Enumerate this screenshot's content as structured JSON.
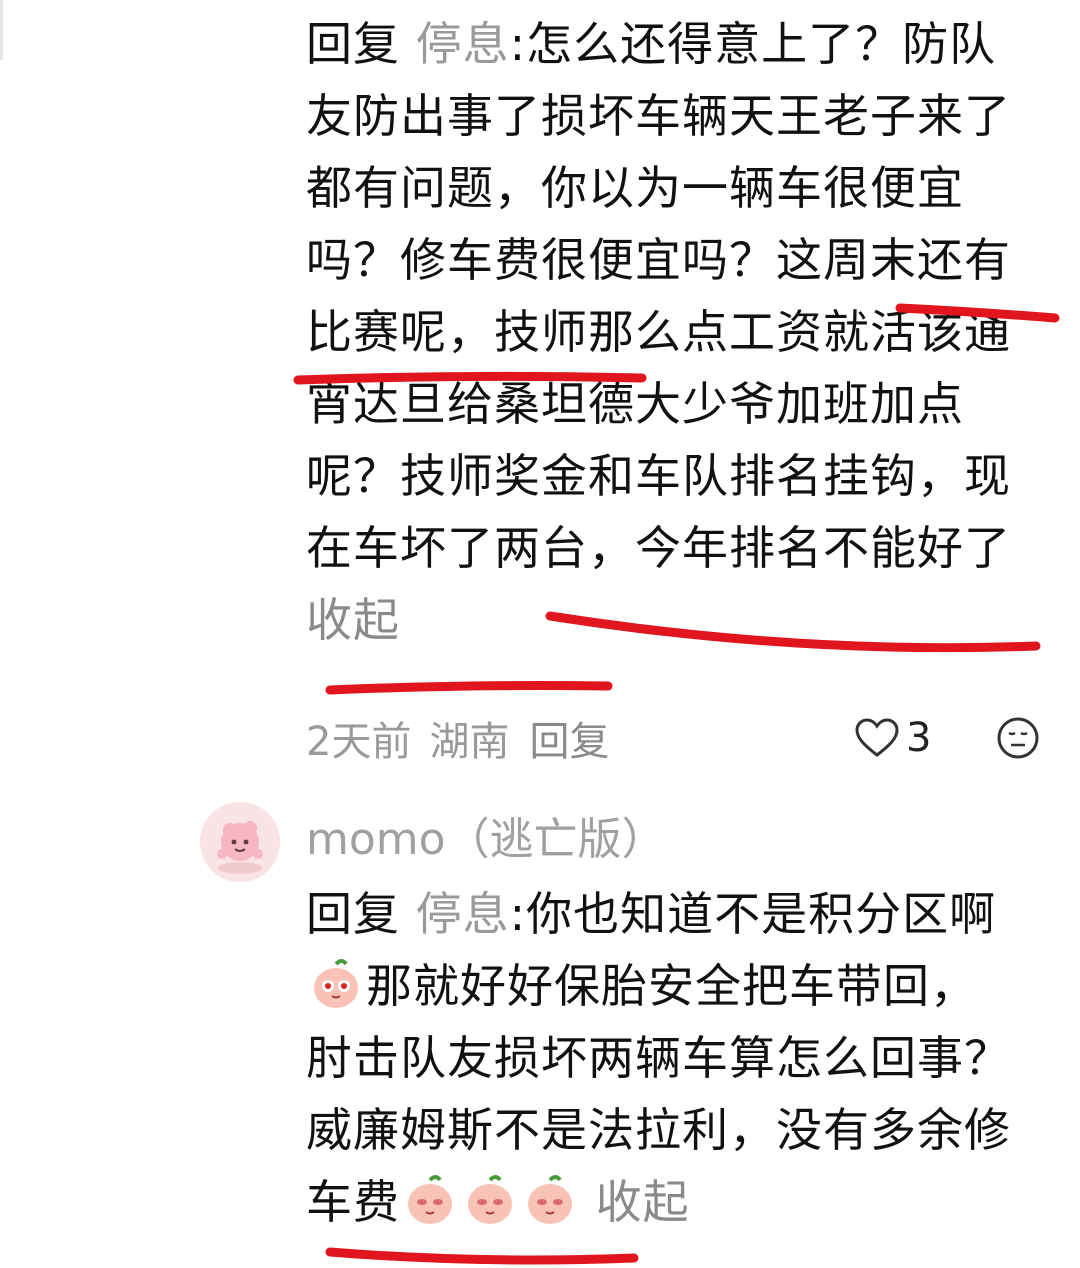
{
  "comment1": {
    "reply_label": "回复",
    "reply_target": "停息",
    "separator": ":",
    "body": "怎么还得意上了？防队友防出事了损坏车辆天王老子来了都有问题，你以为一辆车很便宜吗？修车费很便宜吗？这周末还有比赛呢，技师那么点工资就活该通宵达旦给桑坦德大少爷加班加点呢？技师奖金和车队排名挂钩，现在车坏了两台，今年排名不能好了",
    "collapse": "收起"
  },
  "meta1": {
    "time": "2天前",
    "location": "湖南",
    "reply": "回复",
    "likes": "3"
  },
  "comment2": {
    "username": "momo（逃亡版）",
    "reply_label": "回复",
    "reply_target": "停息",
    "separator": ":",
    "part1": "你也知道不是积分区啊",
    "part2": "那就好好保胎安全把车带回，肘击队友损坏两辆车算怎么回事？威廉姆斯不是法拉利，没有多余修车费",
    "collapse": "收起"
  },
  "icons": {
    "like": "heart-outline-icon",
    "react": "emoji-face-icon",
    "sticker": "peach-sticker-icon"
  },
  "colors": {
    "underline": "#e0151e",
    "muted_text": "#9a9a9a"
  }
}
